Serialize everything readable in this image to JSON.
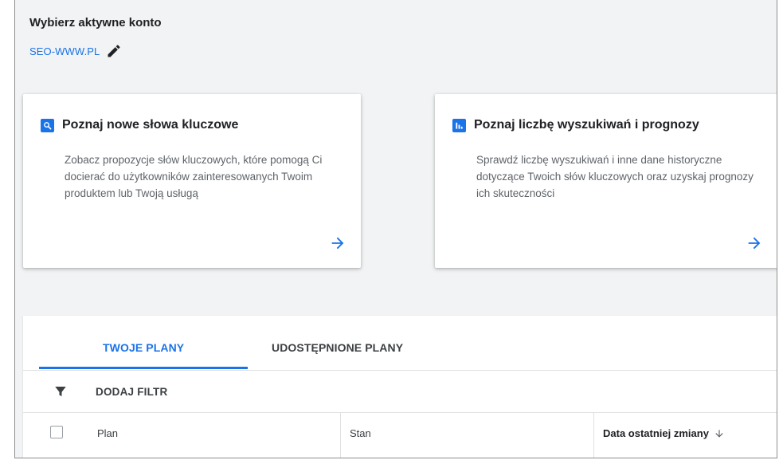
{
  "account": {
    "title": "Wybierz aktywne konto",
    "name": "SEO-WWW.PL",
    "edit_icon": "pencil-icon"
  },
  "cards": [
    {
      "icon": "search-icon",
      "title": "Poznaj nowe słowa kluczowe",
      "description": "Zobacz propozycje słów kluczowych, które pomogą Ci docierać do użytkowników zainteresowanych Twoim produktem lub Twoją usługą",
      "arrow_icon": "arrow-right-icon"
    },
    {
      "icon": "bar-chart-icon",
      "title": "Poznaj liczbę wyszukiwań i prognozy",
      "description": "Sprawdź liczbę wyszukiwań i inne dane historyczne dotyczące Twoich słów kluczowych oraz uzyskaj prognozy ich skuteczności",
      "arrow_icon": "arrow-right-icon"
    }
  ],
  "tabs": [
    {
      "label": "TWOJE PLANY",
      "active": true
    },
    {
      "label": "UDOSTĘPNIONE PLANY",
      "active": false
    }
  ],
  "filter": {
    "icon": "filter-icon",
    "label": "DODAJ FILTR"
  },
  "table": {
    "columns": [
      "Plan",
      "Stan",
      "Data ostatniej zmiany"
    ],
    "sort_icon": "arrow-down-icon"
  },
  "colors": {
    "accent": "#1a73e8",
    "background": "#f1f3f4",
    "text": "#202124",
    "secondary_text": "#5f6368"
  }
}
